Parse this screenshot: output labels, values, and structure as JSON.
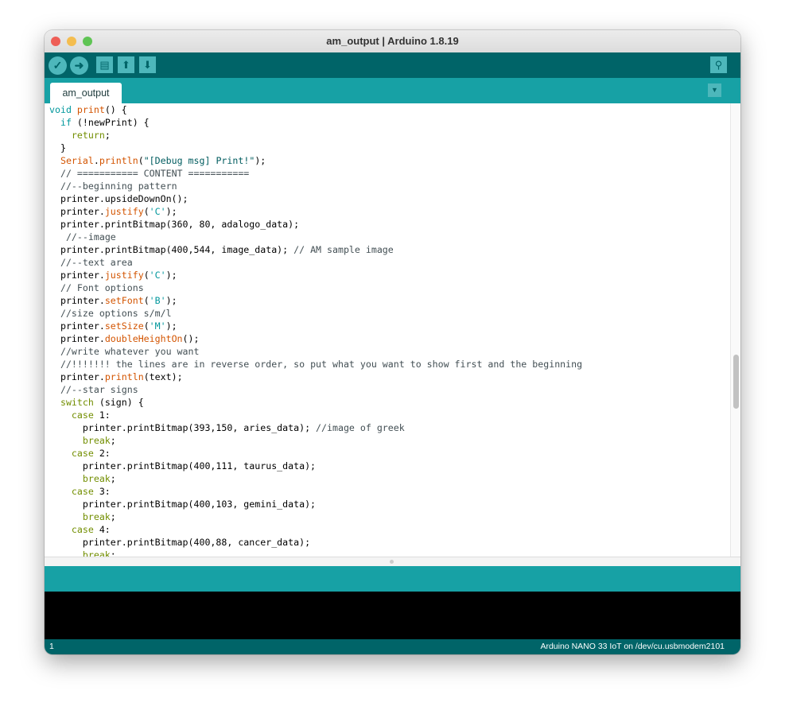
{
  "window": {
    "title": "am_output | Arduino 1.8.19"
  },
  "toolbar": {
    "verify": "verify-icon",
    "upload": "upload-icon",
    "new": "new-file-icon",
    "open": "open-icon",
    "save": "save-icon",
    "serial_monitor": "serial-monitor-icon"
  },
  "tabs": [
    {
      "label": "am_output",
      "active": true
    }
  ],
  "colors": {
    "toolbar": "#006468",
    "tabbar": "#17a1a5",
    "keyword": "#00979c",
    "keyword2": "#728e00",
    "function": "#d35400",
    "string": "#005c5f",
    "comment": "#434f54"
  },
  "code": {
    "lines": [
      [
        [
          "void",
          "k1"
        ],
        [
          " "
        ],
        [
          "print",
          "fn"
        ],
        [
          "() {"
        ]
      ],
      [
        [
          "  "
        ],
        [
          "if",
          "k1"
        ],
        [
          " (!newPrint) {"
        ]
      ],
      [
        [
          "    "
        ],
        [
          "return",
          "k2"
        ],
        [
          ";"
        ]
      ],
      [
        [
          "  }"
        ]
      ],
      [
        [
          "  "
        ],
        [
          "Serial",
          "fn"
        ],
        [
          "."
        ],
        [
          "println",
          "fn"
        ],
        [
          "("
        ],
        [
          "\"[Debug msg] Print!\"",
          "str"
        ],
        [
          ");"
        ]
      ],
      [
        [
          "  "
        ],
        [
          "// =========== CONTENT ===========",
          "cm"
        ]
      ],
      [
        [
          "  "
        ],
        [
          "//--beginning pattern",
          "cm"
        ]
      ],
      [
        [
          "  printer.upsideDownOn();"
        ]
      ],
      [
        [
          "  printer."
        ],
        [
          "justify",
          "fn"
        ],
        [
          "("
        ],
        [
          "'C'",
          "k1"
        ],
        [
          ");"
        ]
      ],
      [
        [
          "  printer.printBitmap(360, 80, adalogo_data);"
        ]
      ],
      [
        [
          "   "
        ],
        [
          "//--image",
          "cm"
        ]
      ],
      [
        [
          "  printer.printBitmap(400,544, image_data); "
        ],
        [
          "// AM sample image",
          "cm"
        ]
      ],
      [
        [
          "  "
        ],
        [
          "//--text area",
          "cm"
        ]
      ],
      [
        [
          "  printer."
        ],
        [
          "justify",
          "fn"
        ],
        [
          "("
        ],
        [
          "'C'",
          "k1"
        ],
        [
          ");"
        ]
      ],
      [
        [
          "  "
        ],
        [
          "// Font options",
          "cm"
        ]
      ],
      [
        [
          "  printer."
        ],
        [
          "setFont",
          "fn"
        ],
        [
          "("
        ],
        [
          "'B'",
          "k1"
        ],
        [
          ");"
        ]
      ],
      [
        [
          "  "
        ],
        [
          "//size options s/m/l",
          "cm"
        ]
      ],
      [
        [
          "  printer."
        ],
        [
          "setSize",
          "fn"
        ],
        [
          "("
        ],
        [
          "'M'",
          "k1"
        ],
        [
          ");"
        ]
      ],
      [
        [
          "  printer."
        ],
        [
          "doubleHeightOn",
          "fn"
        ],
        [
          "();"
        ]
      ],
      [
        [
          "  "
        ],
        [
          "//write whatever you want",
          "cm"
        ]
      ],
      [
        [
          "  "
        ],
        [
          "//!!!!!!! the lines are in reverse order, so put what you want to show first and the beginning",
          "cm"
        ]
      ],
      [
        [
          "  printer."
        ],
        [
          "println",
          "fn"
        ],
        [
          "(text);"
        ]
      ],
      [
        [
          "  "
        ],
        [
          "//--star signs",
          "cm"
        ]
      ],
      [
        [
          "  "
        ],
        [
          "switch",
          "k2"
        ],
        [
          " (sign) {"
        ]
      ],
      [
        [
          "    "
        ],
        [
          "case",
          "k2"
        ],
        [
          " 1:"
        ]
      ],
      [
        [
          "      printer.printBitmap(393,150, aries_data); "
        ],
        [
          "//image of greek",
          "cm"
        ]
      ],
      [
        [
          "      "
        ],
        [
          "break",
          "k2"
        ],
        [
          ";"
        ]
      ],
      [
        [
          "    "
        ],
        [
          "case",
          "k2"
        ],
        [
          " 2:"
        ]
      ],
      [
        [
          "      printer.printBitmap(400,111, taurus_data);"
        ]
      ],
      [
        [
          "      "
        ],
        [
          "break",
          "k2"
        ],
        [
          ";"
        ]
      ],
      [
        [
          "    "
        ],
        [
          "case",
          "k2"
        ],
        [
          " 3:"
        ]
      ],
      [
        [
          "      printer.printBitmap(400,103, gemini_data);"
        ]
      ],
      [
        [
          "      "
        ],
        [
          "break",
          "k2"
        ],
        [
          ";"
        ]
      ],
      [
        [
          "    "
        ],
        [
          "case",
          "k2"
        ],
        [
          " 4:"
        ]
      ],
      [
        [
          "      printer.printBitmap(400,88, cancer_data);"
        ]
      ],
      [
        [
          "      "
        ],
        [
          "break",
          "k2"
        ],
        [
          ";"
        ]
      ]
    ]
  },
  "status": {
    "line": "1",
    "board": "Arduino NANO 33 IoT on /dev/cu.usbmodem2101"
  }
}
